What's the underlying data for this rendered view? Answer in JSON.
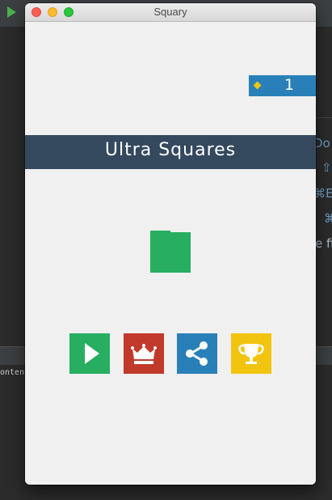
{
  "ide": {
    "right_panel_fragments": [
      "Do",
      "⇧",
      "⌘E",
      "⌘",
      "e fi"
    ],
    "console_fragment": "onten"
  },
  "window": {
    "title": "Squary"
  },
  "game": {
    "score": "1",
    "title": "Ultra Squares",
    "colors": {
      "background": "#f0f0f0",
      "banner": "#34495e",
      "score_box": "#2980b9",
      "diamond": "#f1c40f",
      "square": "#27ae60",
      "play": "#27ae60",
      "crown": "#c0392b",
      "share": "#2980b9",
      "trophy": "#f1c40f"
    },
    "buttons": [
      {
        "name": "play",
        "icon": "play-icon"
      },
      {
        "name": "leaderboard",
        "icon": "crown-icon"
      },
      {
        "name": "share",
        "icon": "share-icon"
      },
      {
        "name": "achievements",
        "icon": "trophy-icon"
      }
    ]
  }
}
